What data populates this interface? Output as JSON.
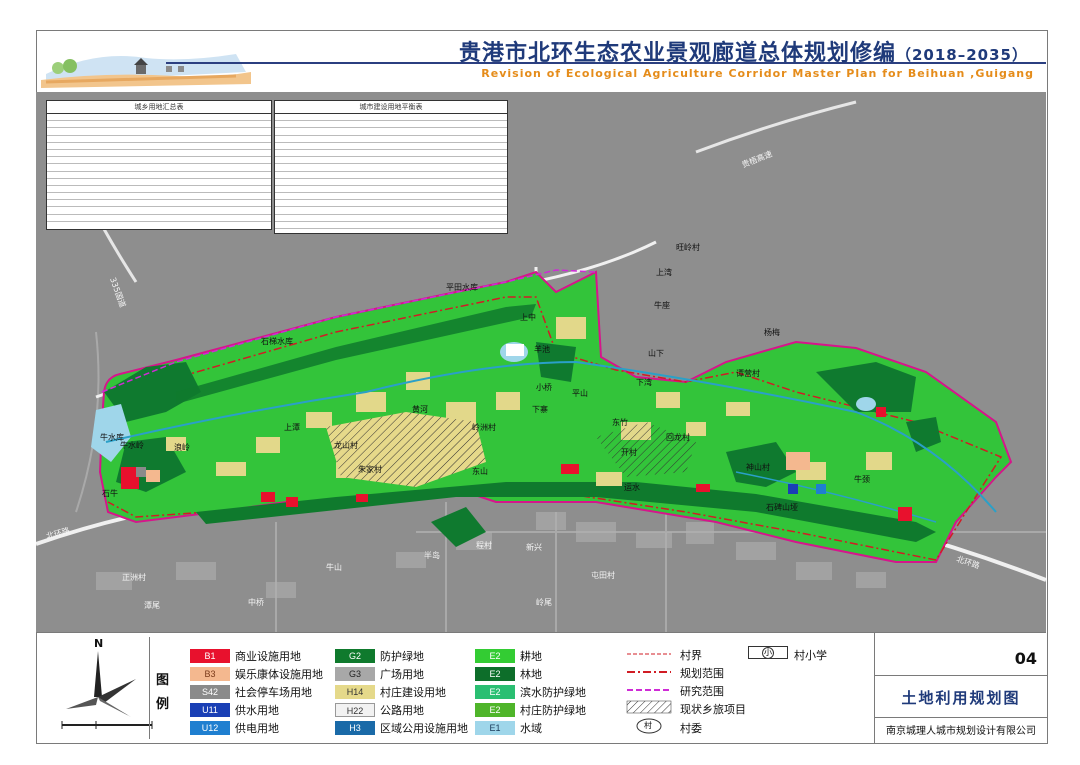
{
  "title": {
    "main": "贵港市北环生态农业景观廊道总体规划修编",
    "years": "（2018–2035）",
    "english": "Revision of Ecological Agriculture Corridor Master Plan for Beihuan ,Guigang"
  },
  "tables": {
    "left_title": "城乡用地汇总表",
    "right_title": "城市建设用地平衡表"
  },
  "map_labels": {
    "road_335": "335国道",
    "road_beihuan_left": "北环路",
    "road_beihuan_right": "北环路",
    "road_guiwu": "贵梧高速",
    "pingtian_reservoir": "平田水库",
    "shiti_reservoir": "石梯水库",
    "niushui_reservoir": "牛水库",
    "wangling_village": "旺岭村",
    "shangwan": "上湾",
    "xiawan": "下湾",
    "yangmei": "杨梅",
    "niushuiling": "牛水岭",
    "shiniu": "石牛",
    "zhengzhou_village": "正洲村",
    "tanwei": "潭尾",
    "lingwei": "岭尾",
    "xiaoqiao": "小桥",
    "huanghe": "黄河",
    "shanxia": "山下",
    "niuzuo": "牛座",
    "dongzhu": "东竹",
    "lingzhou_village": "岭洲村",
    "kaicun": "开村",
    "huilong_village": "回龙村",
    "shenshan_village": "神山村",
    "shangtan": "上潭",
    "sheshui_point": "石碑山垭",
    "langling": "浪岭",
    "longshan_village": "龙山村",
    "zhujia_village": "朱家村",
    "dongshan": "东山",
    "pingshan": "平山",
    "tanying": "谭营村",
    "xinxing": "新兴",
    "yunshui": "运水",
    "niushan": "牛山",
    "bandao": "半岛",
    "niujing": "牛颈",
    "cheng_village": "程村",
    "shangzhong": "上中",
    "yangchi": "羊池",
    "xiazhai": "下寨",
    "zhongqiao": "中桥",
    "tudian": "屯田村"
  },
  "legend": {
    "title": "图例",
    "items": [
      {
        "code": "B1",
        "label": "商业设施用地",
        "color": "#e8112d"
      },
      {
        "code": "B3",
        "label": "娱乐康体设施用地",
        "color": "#f4b88f"
      },
      {
        "code": "S42",
        "label": "社会停车场用地",
        "color": "#8a8a8a"
      },
      {
        "code": "U11",
        "label": "供水用地",
        "color": "#1a3fb5"
      },
      {
        "code": "U12",
        "label": "供电用地",
        "color": "#1f7fd0"
      },
      {
        "code": "G2",
        "label": "防护绿地",
        "color": "#0f7a2d"
      },
      {
        "code": "G3",
        "label": "广场用地",
        "color": "#a8a8a8"
      },
      {
        "code": "H14",
        "label": "村庄建设用地",
        "color": "#e5d98a"
      },
      {
        "code": "H22",
        "label": "公路用地",
        "color": "#f2f2f2"
      },
      {
        "code": "H3",
        "label": "区域公用设施用地",
        "color": "#1a6aa8"
      },
      {
        "code": "E2",
        "label": "耕地",
        "color": "#33cc33"
      },
      {
        "code": "E2",
        "label": "林地",
        "color": "#0d6e2a"
      },
      {
        "code": "E2",
        "label": "滨水防护绿地",
        "color": "#2abf72"
      },
      {
        "code": "E2",
        "label": "村庄防护绿地",
        "color": "#4fb52a"
      },
      {
        "code": "E1",
        "label": "水域",
        "color": "#9fd6ea"
      }
    ],
    "lines": [
      {
        "label": "村界"
      },
      {
        "label": "规划范围"
      },
      {
        "label": "研究范围"
      },
      {
        "label": "现状乡旅项目"
      },
      {
        "label": "村委"
      }
    ],
    "school": {
      "symbol": "小",
      "label": "村小学"
    },
    "committee_symbol": "村"
  },
  "sheet": {
    "number": "04",
    "name": "土地利用规划图",
    "company": "南京城理人城市规划设计有限公司"
  },
  "compass": {
    "north": "N"
  }
}
